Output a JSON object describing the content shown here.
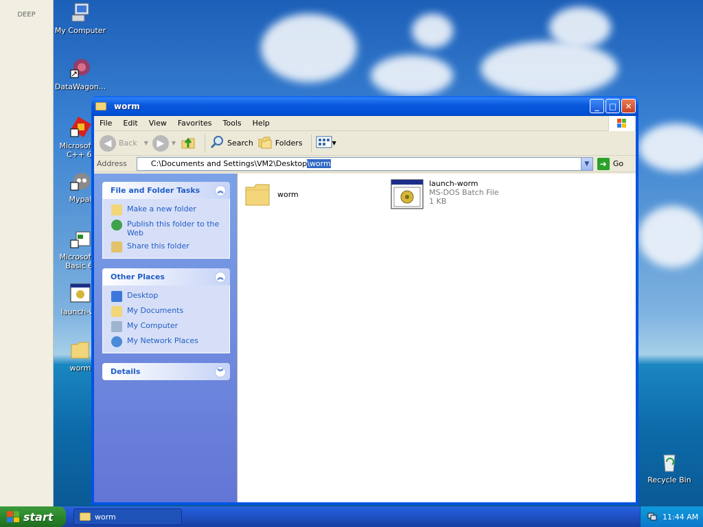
{
  "desktop": {
    "sidebar_label": "DEEP",
    "icons": [
      {
        "label": "My Computer",
        "icon": "computer-icon"
      },
      {
        "label": "DataWagon...",
        "icon": "datawagon-shortcut-icon"
      },
      {
        "label": "Microsoft V\nC++ 6.",
        "icon": "visual-cpp-shortcut-icon"
      },
      {
        "label": "Mypal",
        "icon": "mypal-browser-icon"
      },
      {
        "label": "Microsoft V\nBasic 6.",
        "icon": "visual-basic-shortcut-icon"
      },
      {
        "label": "launch-wo",
        "icon": "batch-file-icon"
      },
      {
        "label": "worm",
        "icon": "folder-icon"
      },
      {
        "label": "Recycle Bin",
        "icon": "recycle-bin-icon"
      }
    ]
  },
  "window": {
    "title": "worm",
    "menu": [
      "File",
      "Edit",
      "View",
      "Favorites",
      "Tools",
      "Help"
    ],
    "toolbar": {
      "back": "Back",
      "search": "Search",
      "folders": "Folders"
    },
    "address": {
      "label": "Address",
      "path_prefix": "C:\\Documents and Settings\\VM2\\Desktop",
      "path_selected": "\\worm",
      "go": "Go"
    },
    "tasks": {
      "file_folder_title": "File and Folder Tasks",
      "file_folder_items": [
        "Make a new folder",
        "Publish this folder to the Web",
        "Share this folder"
      ],
      "other_places_title": "Other Places",
      "other_places_items": [
        "Desktop",
        "My Documents",
        "My Computer",
        "My Network Places"
      ],
      "details_title": "Details"
    },
    "files": [
      {
        "name": "worm",
        "type": "",
        "size": ""
      },
      {
        "name": "launch-worm",
        "type": "MS-DOS Batch File",
        "size": "1 KB"
      }
    ]
  },
  "taskbar": {
    "start": "start",
    "task_item": "worm",
    "clock": "11:44 AM"
  },
  "colors": {
    "xp_blue": "#0054e3",
    "link_blue": "#215dc6",
    "start_green": "#2e8b2e"
  }
}
